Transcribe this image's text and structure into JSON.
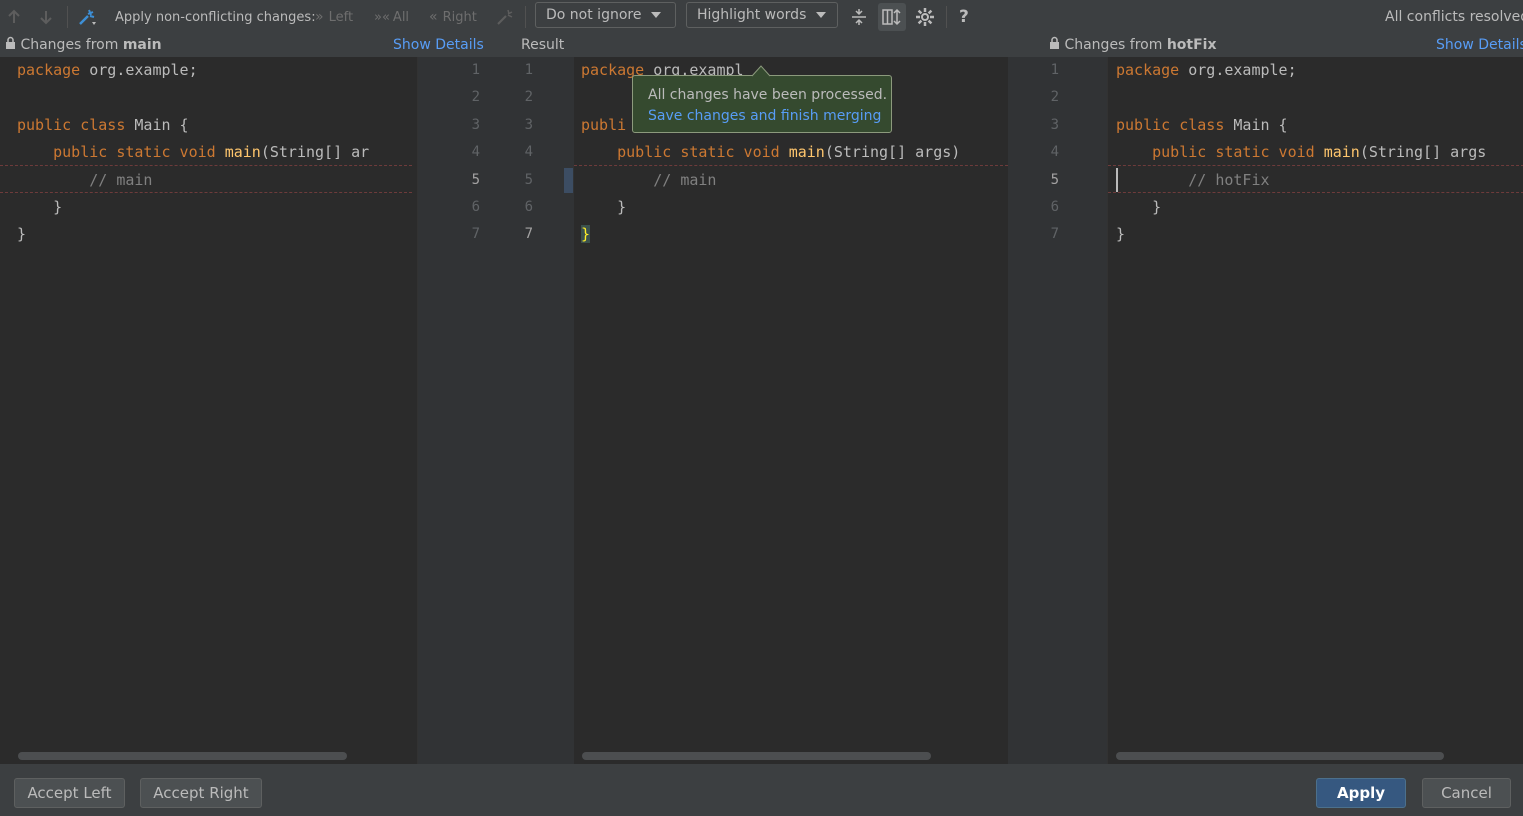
{
  "toolbar": {
    "apply_label": "Apply non-conflicting changes:",
    "left": "Left",
    "all": "All",
    "right": "Right",
    "ignore_select": "Do not ignore",
    "highlight_select": "Highlight words",
    "help": "?",
    "status": "All conflicts resolved"
  },
  "headers": {
    "left_prefix": "Changes from ",
    "left_branch": "main",
    "show_details": "Show Details",
    "result": "Result",
    "right_prefix": "Changes from ",
    "right_branch": "hotFix"
  },
  "line_numbers": [
    "1",
    "2",
    "3",
    "4",
    "5",
    "6",
    "7"
  ],
  "left_code": {
    "l1a": "package",
    "l1b": " org.example;",
    "l3a": "public class",
    "l3b": " Main {",
    "l4a": "    public static void ",
    "l4b": "main",
    "l4c": "(String[] ar",
    "l5": "        // main",
    "l6": "    }",
    "l7": "}"
  },
  "center_code": {
    "l1a": "package",
    "l1b": " org.exampl",
    "l3a": "publi",
    "l4a": "    public static void ",
    "l4b": "main",
    "l4c": "(String[] args)",
    "l5": "        // main",
    "l6": "    }",
    "l7": "}"
  },
  "right_code": {
    "l1a": "package",
    "l1b": " org.example;",
    "l3a": "public class",
    "l3b": " Main {",
    "l4a": "    public static void ",
    "l4b": "main",
    "l4c": "(String[] args",
    "l5": "        // hotFix",
    "l6": "    }",
    "l7": "}"
  },
  "popup": {
    "text": "All changes have been processed.",
    "link": "Save changes and finish merging"
  },
  "buttons": {
    "accept_left": "Accept Left",
    "accept_right": "Accept Right",
    "apply": "Apply",
    "cancel": "Cancel"
  }
}
